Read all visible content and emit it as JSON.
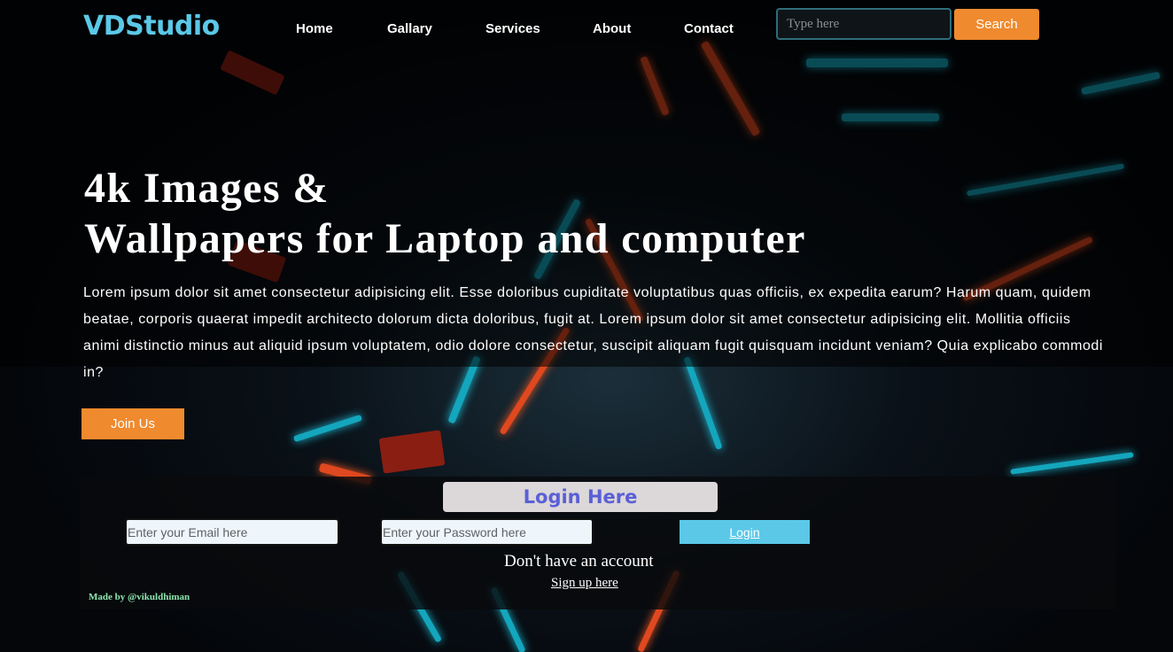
{
  "header": {
    "brand": "VDStudio",
    "nav": [
      "Home",
      "Gallary",
      "Services",
      "About",
      "Contact"
    ],
    "search": {
      "placeholder": "Type here",
      "value": "",
      "button_label": "Search"
    }
  },
  "hero": {
    "title_line1": "4k Images &",
    "title_line2": "Wallpapers for Laptop and computer",
    "description": "Lorem ipsum dolor sit amet consectetur adipisicing elit. Esse doloribus cupiditate voluptatibus quas officiis, ex expedita earum? Harum quam, quidem beatae, corporis quaerat impedit architecto dolorum dicta doloribus, fugit at. Lorem ipsum dolor sit amet consectetur adipisicing elit. Mollitia officiis animi distinctio minus aut aliquid ipsum voluptatem, odio dolore consectetur, suscipit aliquam fugit quisquam incidunt veniam? Quia explicabo commodi in?",
    "join_label": "Join Us"
  },
  "login": {
    "heading": "Login Here",
    "email_placeholder": "Enter your Email here",
    "password_placeholder": "Enter your Password here",
    "button_label": "Login",
    "no_account": "Don't have an account",
    "signup_label": "Sign up here"
  },
  "footer": {
    "credit": "Made by @vikuldhiman"
  },
  "colors": {
    "brand": "#5bc8e8",
    "accent_orange": "#ef8a2e",
    "login_heading_text": "#5a5fd6",
    "credit_text": "#8ee6b0"
  }
}
